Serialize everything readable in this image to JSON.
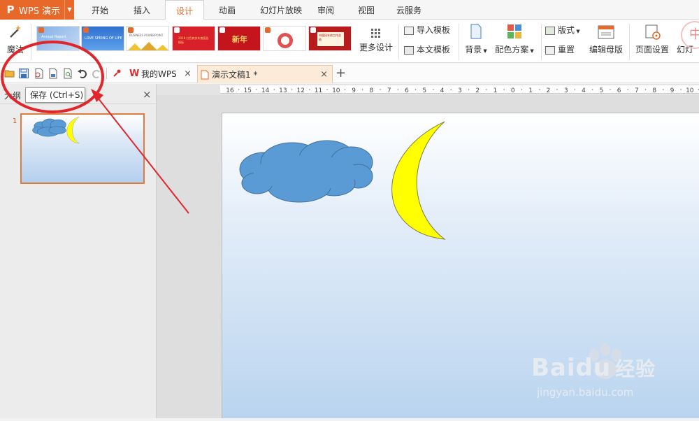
{
  "app": {
    "logo_letter": "P",
    "name": "WPS 演示",
    "accent": "#e8682a"
  },
  "menu_tabs": [
    "开始",
    "插入",
    "设计",
    "动画",
    "幻灯片放映",
    "审阅",
    "视图",
    "云服务"
  ],
  "active_tab": "设计",
  "ribbon": {
    "magic_label": "魔法",
    "more_designs": "更多设计",
    "import_template": "导入模板",
    "text_template": "本文模板",
    "background": "背景",
    "color_scheme": "配色方案",
    "layout": "版式",
    "reset": "重置",
    "edit_master": "编辑母版",
    "page_setup": "页面设置",
    "slide_size_partial": "幻灯",
    "design_thumbs": [
      {
        "caption": "Annual Report"
      },
      {
        "caption": "LOVE SPRING OF LIFE"
      },
      {
        "caption": "BUSINESS POWERPOINT"
      },
      {
        "caption": "2018 红色商务年度报告模板"
      },
      {
        "caption": "新年"
      },
      {
        "caption": ""
      },
      {
        "caption": "中国风年终工作总结"
      }
    ]
  },
  "doc_tabs": [
    {
      "label": "我的WPS",
      "close": "×"
    },
    {
      "label": "演示文稿1 *",
      "close": "×"
    }
  ],
  "new_tab": "+",
  "left_pane": {
    "tab_label": "大纲",
    "close": "×",
    "slide_number": "1"
  },
  "tooltip": "保存 (Ctrl+S)",
  "ruler_ticks": [
    "16",
    "15",
    "14",
    "13",
    "12",
    "11",
    "10",
    "9",
    "8",
    "7",
    "6",
    "5",
    "4",
    "3",
    "2",
    "1",
    "0",
    "1",
    "2",
    "3",
    "4",
    "5",
    "6",
    "7",
    "8",
    "9",
    "10"
  ],
  "shapes": {
    "cloud_color": "#5b9bd5",
    "moon_color": "#ffff00"
  },
  "watermark": {
    "brand": "Baidu",
    "brand_cn": "经验",
    "url": "jingyan.baidu.com"
  }
}
